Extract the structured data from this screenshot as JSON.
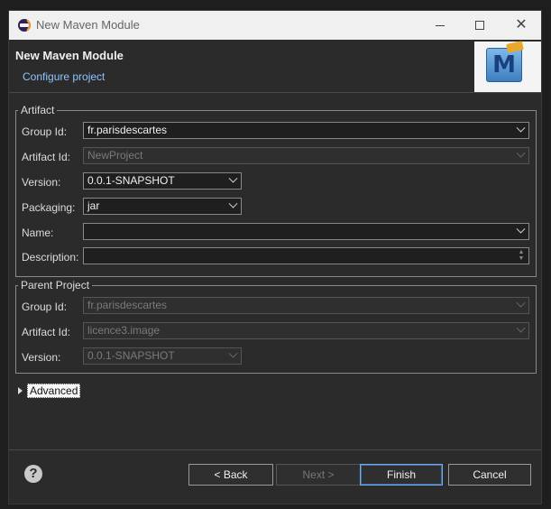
{
  "window": {
    "title": "New Maven Module"
  },
  "header": {
    "title": "New Maven Module",
    "subtitle": "Configure project",
    "logo_letter": "M"
  },
  "artifact": {
    "legend": "Artifact",
    "group_id_label": "Group Id:",
    "group_id_value": "fr.parisdescartes",
    "artifact_id_label": "Artifact Id:",
    "artifact_id_value": "NewProject",
    "version_label": "Version:",
    "version_value": "0.0.1-SNAPSHOT",
    "packaging_label": "Packaging:",
    "packaging_value": "jar",
    "name_label": "Name:",
    "name_value": "",
    "description_label": "Description:",
    "description_value": ""
  },
  "parent": {
    "legend": "Parent Project",
    "group_id_label": "Group Id:",
    "group_id_value": "fr.parisdescartes",
    "artifact_id_label": "Artifact Id:",
    "artifact_id_value": "licence3.image",
    "version_label": "Version:",
    "version_value": "0.0.1-SNAPSHOT"
  },
  "advanced": {
    "label": "Advanced"
  },
  "buttons": {
    "help": "?",
    "back": "< Back",
    "next": "Next >",
    "finish": "Finish",
    "cancel": "Cancel"
  },
  "icons": {
    "app": "eclipse-icon",
    "help": "help-icon",
    "dropdown": "chevron-down-icon",
    "expand": "triangle-right-icon"
  },
  "colors": {
    "background": "#2b2b2b",
    "link": "#8fc3ff",
    "default_button_border": "#7aa9e0"
  }
}
